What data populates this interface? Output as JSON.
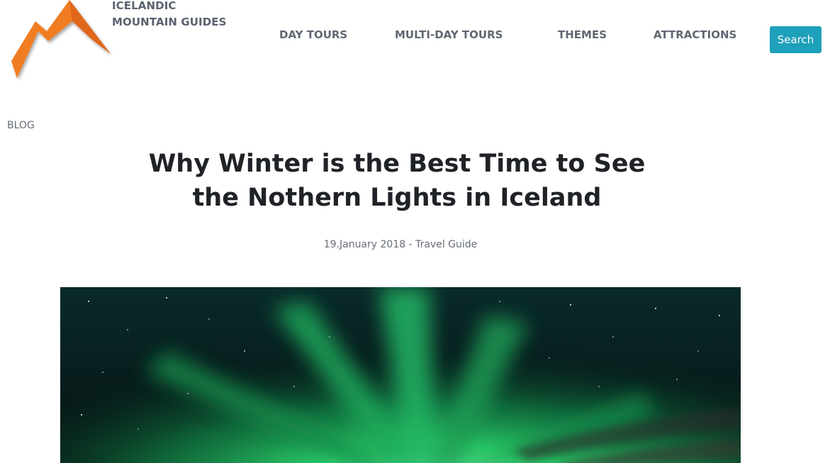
{
  "header": {
    "logo_icon": "mountain-peaks-icon",
    "brand_line1": "ICELANDIC",
    "brand_line2": "MOUNTAIN GUIDES",
    "nav": {
      "day_tours": "DAY TOURS",
      "multi_day_tours": "MULTI-DAY TOURS",
      "themes": "THEMES",
      "attractions": "ATTRACTIONS"
    },
    "search_label": "Search"
  },
  "breadcrumb": "BLOG",
  "article": {
    "title_line1": "Why Winter is the Best Time to See",
    "title_line2": "the Nothern Lights in Iceland",
    "meta": "19.January 2018 - Travel Guide",
    "hero_image": "northern-lights-photo"
  },
  "colors": {
    "logo_orange": "#f07d22",
    "nav_text": "#5f6773",
    "search_button": "#1ea0ba",
    "title_text": "#1f2226",
    "aurora_green": "#3ddc7a"
  }
}
